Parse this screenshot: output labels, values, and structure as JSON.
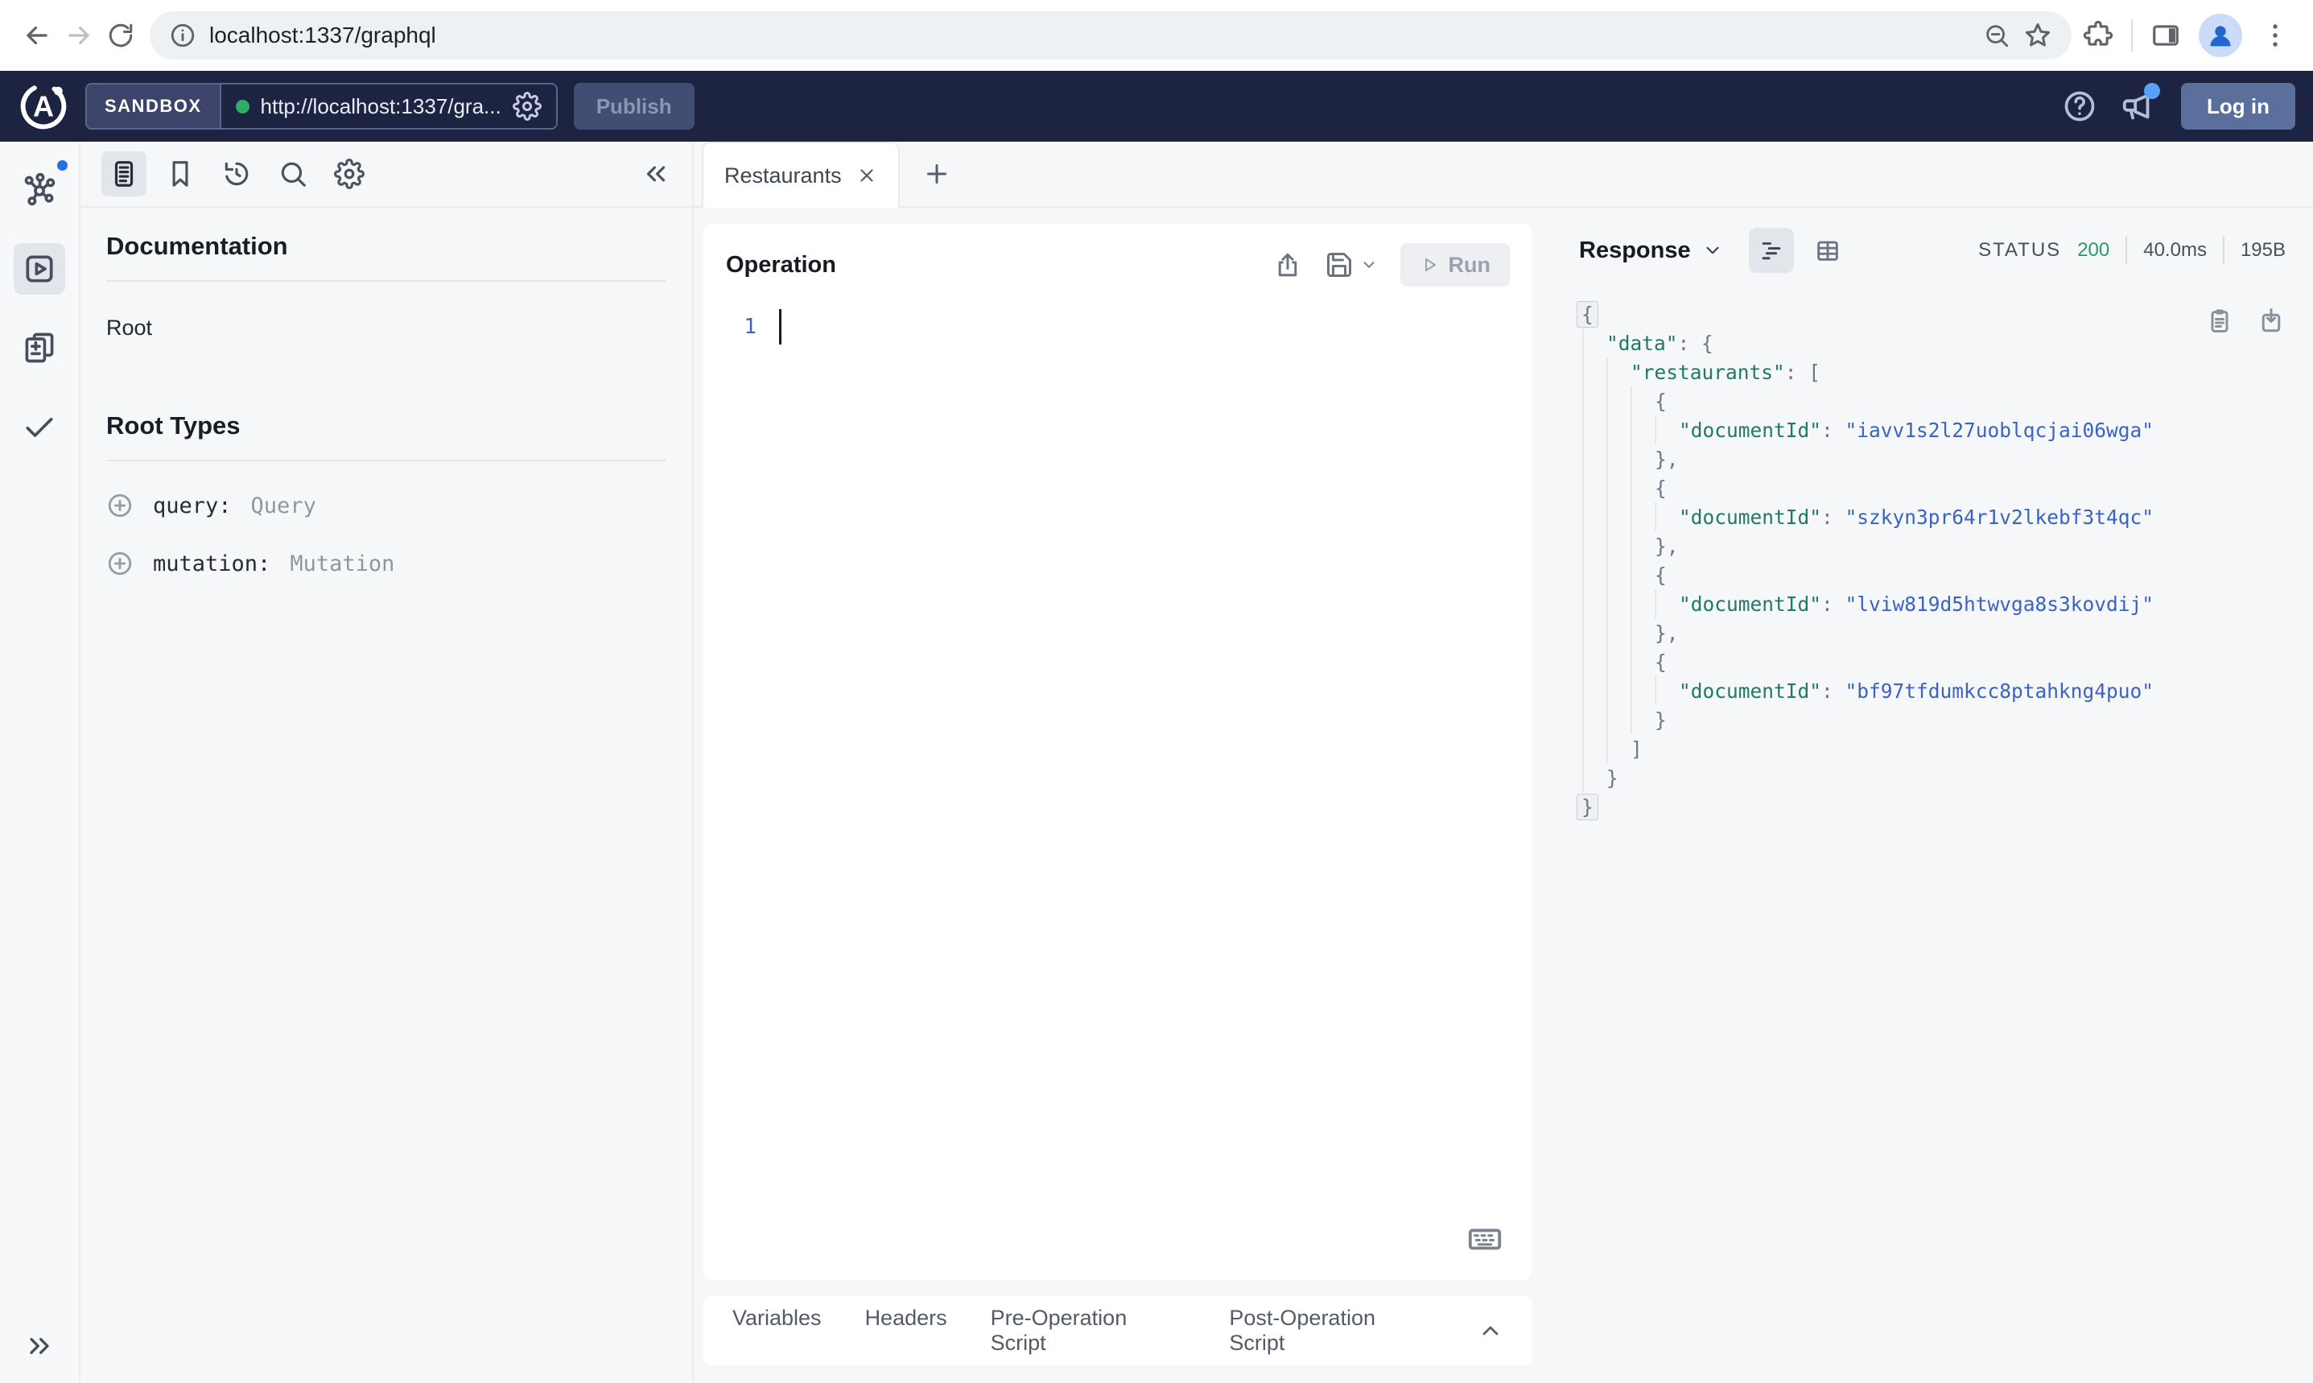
{
  "browser": {
    "url": "localhost:1337/graphql"
  },
  "header": {
    "env": "SANDBOX",
    "endpoint": "http://localhost:1337/gra...",
    "publish": "Publish",
    "login": "Log in",
    "navy": "#1d2441"
  },
  "docs": {
    "title": "Documentation",
    "root": "Root",
    "section": "Root Types",
    "types": [
      {
        "field": "query:",
        "type": "Query"
      },
      {
        "field": "mutation:",
        "type": "Mutation"
      }
    ]
  },
  "editor": {
    "tab": "Restaurants",
    "title": "Operation",
    "run": "Run",
    "line_no": "1",
    "bottom_tabs": [
      "Variables",
      "Headers",
      "Pre-Operation Script",
      "Post-Operation Script"
    ]
  },
  "response": {
    "title": "Response",
    "status_label": "STATUS",
    "status": "200",
    "time": "40.0ms",
    "size": "195B",
    "colors": {
      "key": "#20796a",
      "string": "#3a63c4",
      "status_green": "#2a9b68"
    },
    "body": {
      "data": {
        "restaurants": [
          {
            "documentId": "iavv1s2l27uoblqcjai06wga"
          },
          {
            "documentId": "szkyn3pr64r1v2lkebf3t4qc"
          },
          {
            "documentId": "lviw819d5htwvga8s3kovdij"
          },
          {
            "documentId": "bf97tfdumkcc8ptahkng4puo"
          }
        ]
      }
    }
  }
}
